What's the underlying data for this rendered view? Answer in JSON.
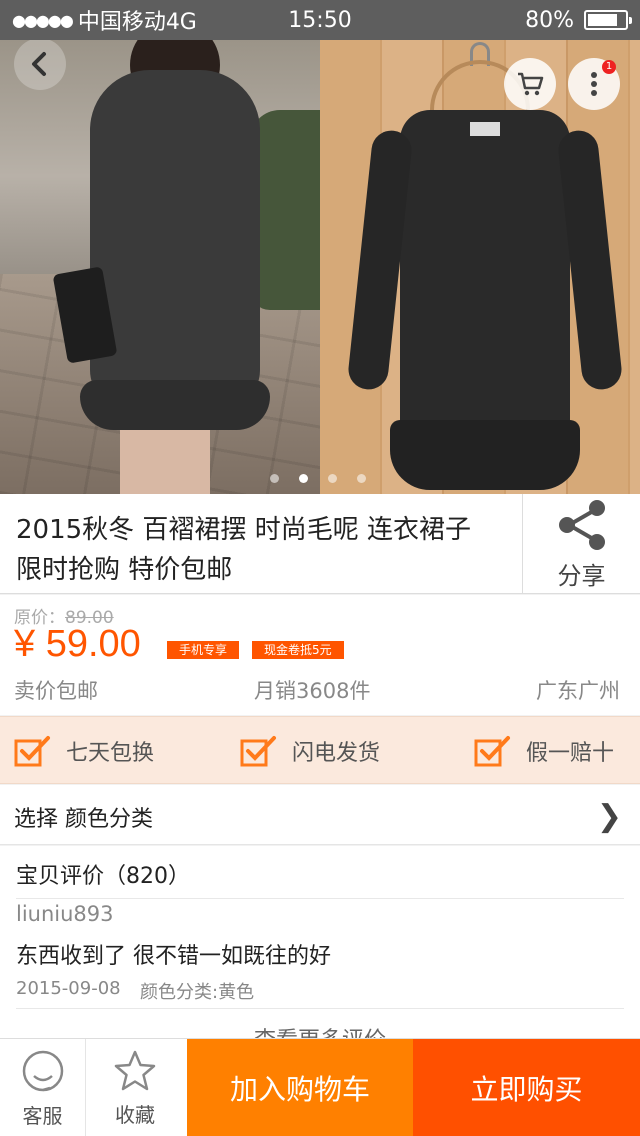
{
  "status_bar": {
    "carrier": "中国移动4G",
    "time": "15:50",
    "battery": "80%",
    "battery_level": 0.8
  },
  "gallery": {
    "page_count": 4,
    "current_page": 2,
    "cart_badge": "1"
  },
  "product": {
    "title_line1": "2015秋冬 百褶裙摆 时尚毛呢 连衣裙子",
    "title_line2": "限时抢购 特价包邮",
    "share_label": "分享"
  },
  "price": {
    "original_label": "原价：",
    "original_value": "89.00",
    "current": "¥ 59.00",
    "tag_mobile": "手机专享",
    "tag_coupon": "现金卷抵5元",
    "shipping": "卖价包邮",
    "monthly_sales": "月销3608件",
    "location": "广东广州"
  },
  "guarantees": [
    "七天包换",
    "闪电发货",
    "假一赔十"
  ],
  "select": {
    "label": "选择 颜色分类",
    "chevron": "❯"
  },
  "reviews": {
    "title": "宝贝评价（820）",
    "user": "liuniu893",
    "text": "东西收到了 很不错一如既往的好",
    "date": "2015-09-08",
    "variant": "颜色分类:黄色",
    "more": "查看更多评价"
  },
  "bottom_bar": {
    "service": "客服",
    "favorite": "收藏",
    "add_to_cart": "加入购物车",
    "buy_now": "立即购买"
  },
  "colors": {
    "accent": "#ff5500",
    "cart_button": "#ff8000",
    "buy_button": "#ff5000",
    "guarantee_bg": "#fbe9dd"
  }
}
